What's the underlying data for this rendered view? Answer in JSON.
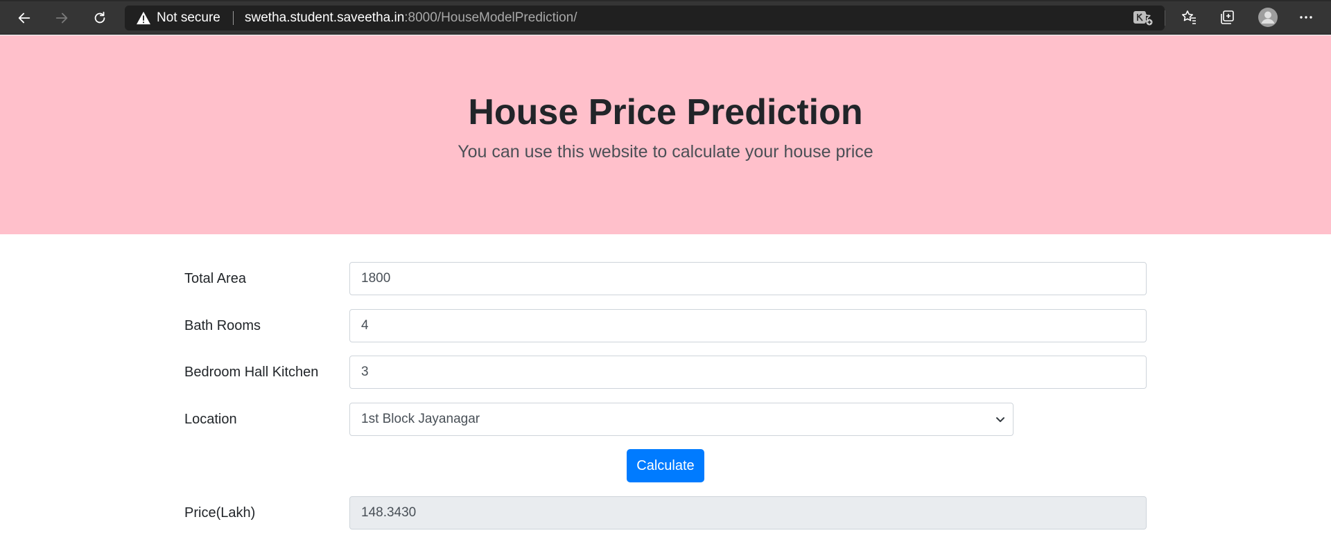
{
  "browser": {
    "security_text": "Not secure",
    "url_host": "swetha.student.saveetha.in",
    "url_rest": ":8000/HouseModelPrediction/"
  },
  "hero": {
    "title": "House Price Prediction",
    "subtitle": "You can use this website to calculate your house price",
    "background": "#ffc0cb"
  },
  "form": {
    "total_area": {
      "label": "Total Area",
      "value": "1800"
    },
    "bath_rooms": {
      "label": "Bath Rooms",
      "value": "4"
    },
    "bhk": {
      "label": "Bedroom Hall Kitchen",
      "value": "3"
    },
    "location": {
      "label": "Location",
      "value": "1st Block Jayanagar"
    },
    "calculate_label": "Calculate",
    "price": {
      "label": "Price(Lakh)",
      "value": "148.3430"
    }
  },
  "colors": {
    "button": "#007bff",
    "readonly_bg": "#e9ecef"
  },
  "icons": [
    "back-icon",
    "forward-icon",
    "refresh-icon",
    "warning-icon",
    "add-favorite-icon",
    "extension-icon",
    "favorites-icon",
    "collections-icon",
    "profile-icon",
    "more-icon",
    "chevron-down-icon"
  ]
}
